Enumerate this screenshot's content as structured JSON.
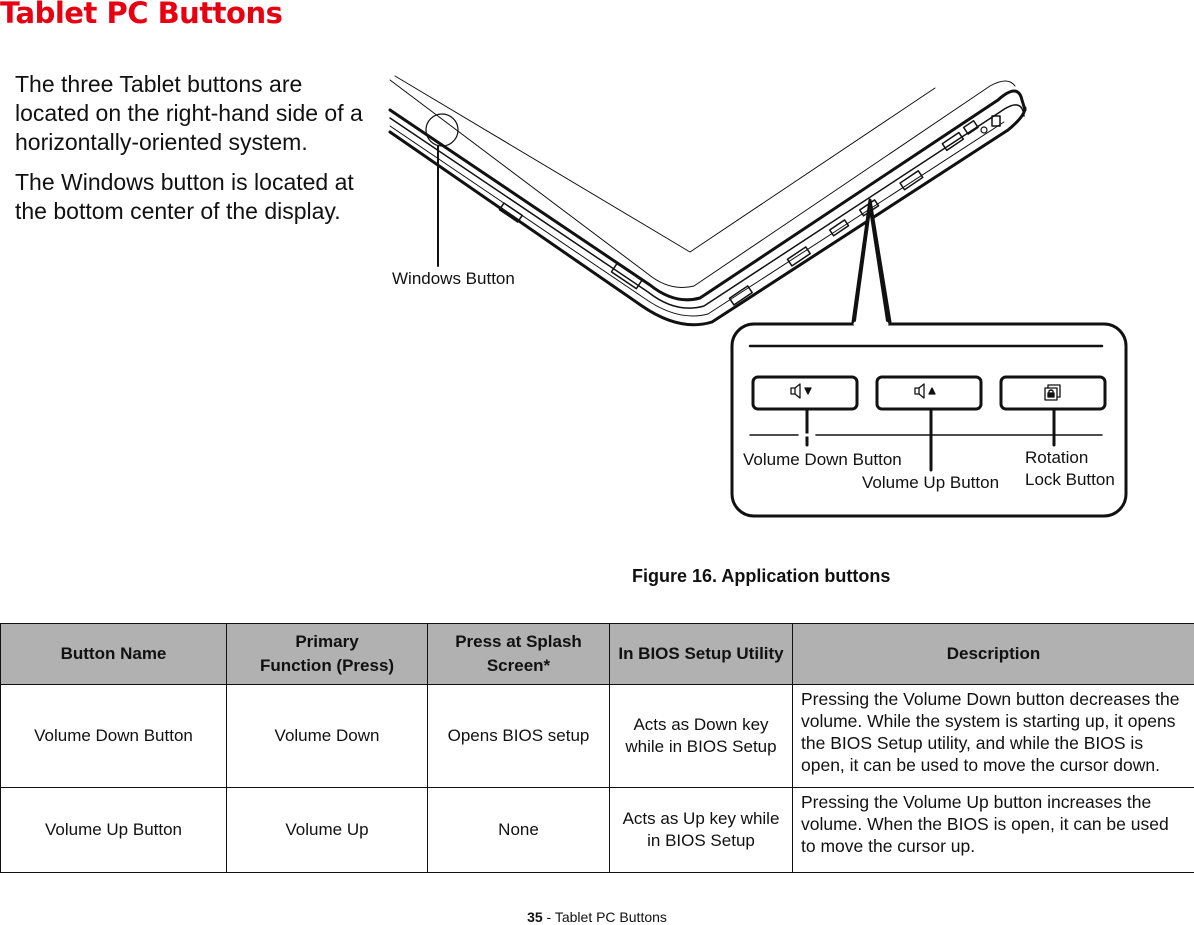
{
  "page": {
    "title": "Tablet PC Buttons",
    "title_color": "#e60012",
    "intro_paragraphs": [
      "The three Tablet buttons are located on the right-hand side of a horizontally-oriented system.",
      "The Windows button is located at the bottom center of the display."
    ]
  },
  "figure": {
    "labels": {
      "windows_button": "Windows Button",
      "volume_down_button": "Volume Down Button",
      "volume_up_button": "Volume Up Button",
      "rotation_lock_line1": "Rotation",
      "rotation_lock_line2": "Lock Button"
    },
    "icons": {
      "volume_down": "speaker-down-icon",
      "volume_up": "speaker-up-icon",
      "rotation_lock": "rotation-lock-icon",
      "windows": "windows-button-circle"
    },
    "caption": "Figure 16.  Application buttons"
  },
  "table": {
    "header_bg": "#b1b1b1",
    "headers": [
      [
        "Button Name"
      ],
      [
        "Primary",
        "Function (Press)"
      ],
      [
        "Press at Splash Screen*"
      ],
      [
        "In BIOS Setup Utility"
      ],
      [
        "Description"
      ]
    ],
    "rows": [
      {
        "button_name": "Volume Down Button",
        "primary_function": "Volume Down",
        "splash_screen": "Opens BIOS setup",
        "bios_setup": "Acts as Down key while in BIOS Setup",
        "description": "Pressing the Volume Down button decreases the volume. While the system is starting up, it opens the BIOS Setup utility, and while the BIOS is open, it can be used to move the cursor down."
      },
      {
        "button_name": "Volume Up Button",
        "primary_function": "Volume Up",
        "splash_screen": "None",
        "bios_setup": "Acts as Up key while in BIOS Setup",
        "description": "Pressing the Volume Up button increases the volume. When the BIOS is open, it can be used to move the cursor up."
      }
    ]
  },
  "footer": {
    "page_number": "35",
    "section": " - Tablet PC Buttons"
  }
}
